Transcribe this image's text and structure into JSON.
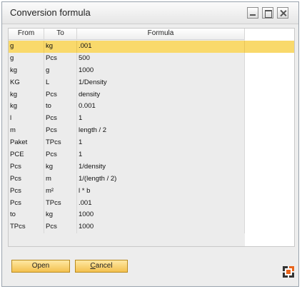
{
  "window": {
    "title": "Conversion formula"
  },
  "table": {
    "headers": [
      "From",
      "To",
      "Formula"
    ],
    "rows": [
      [
        "g",
        "kg",
        ".001"
      ],
      [
        "g",
        "Pcs",
        "500"
      ],
      [
        "kg",
        "g",
        "1000"
      ],
      [
        "KG",
        "L",
        "1/Density"
      ],
      [
        "kg",
        "Pcs",
        "density"
      ],
      [
        "kg",
        "to",
        "0.001"
      ],
      [
        "l",
        "Pcs",
        "1"
      ],
      [
        "m",
        "Pcs",
        "length / 2"
      ],
      [
        "Paket",
        "TPcs",
        "1"
      ],
      [
        "PCE",
        "Pcs",
        "1"
      ],
      [
        "Pcs",
        "kg",
        "1/density"
      ],
      [
        "Pcs",
        "m",
        "1/(length / 2)"
      ],
      [
        "Pcs",
        "m²",
        "l * b"
      ],
      [
        "Pcs",
        "TPcs",
        ".001"
      ],
      [
        "to",
        "kg",
        "1000"
      ],
      [
        "TPcs",
        "Pcs",
        "1000"
      ]
    ],
    "selected_row": 0
  },
  "buttons": {
    "open_label": "Open",
    "cancel_first": "C",
    "cancel_rest": "ancel"
  },
  "icons": {
    "window_minimize": "minimize-icon",
    "window_maximize": "maximize-icon",
    "window_close": "close-icon",
    "corner": "sap-expand-icon"
  },
  "colors": {
    "selection": "#f9d96b",
    "button": "#f3c14f"
  }
}
